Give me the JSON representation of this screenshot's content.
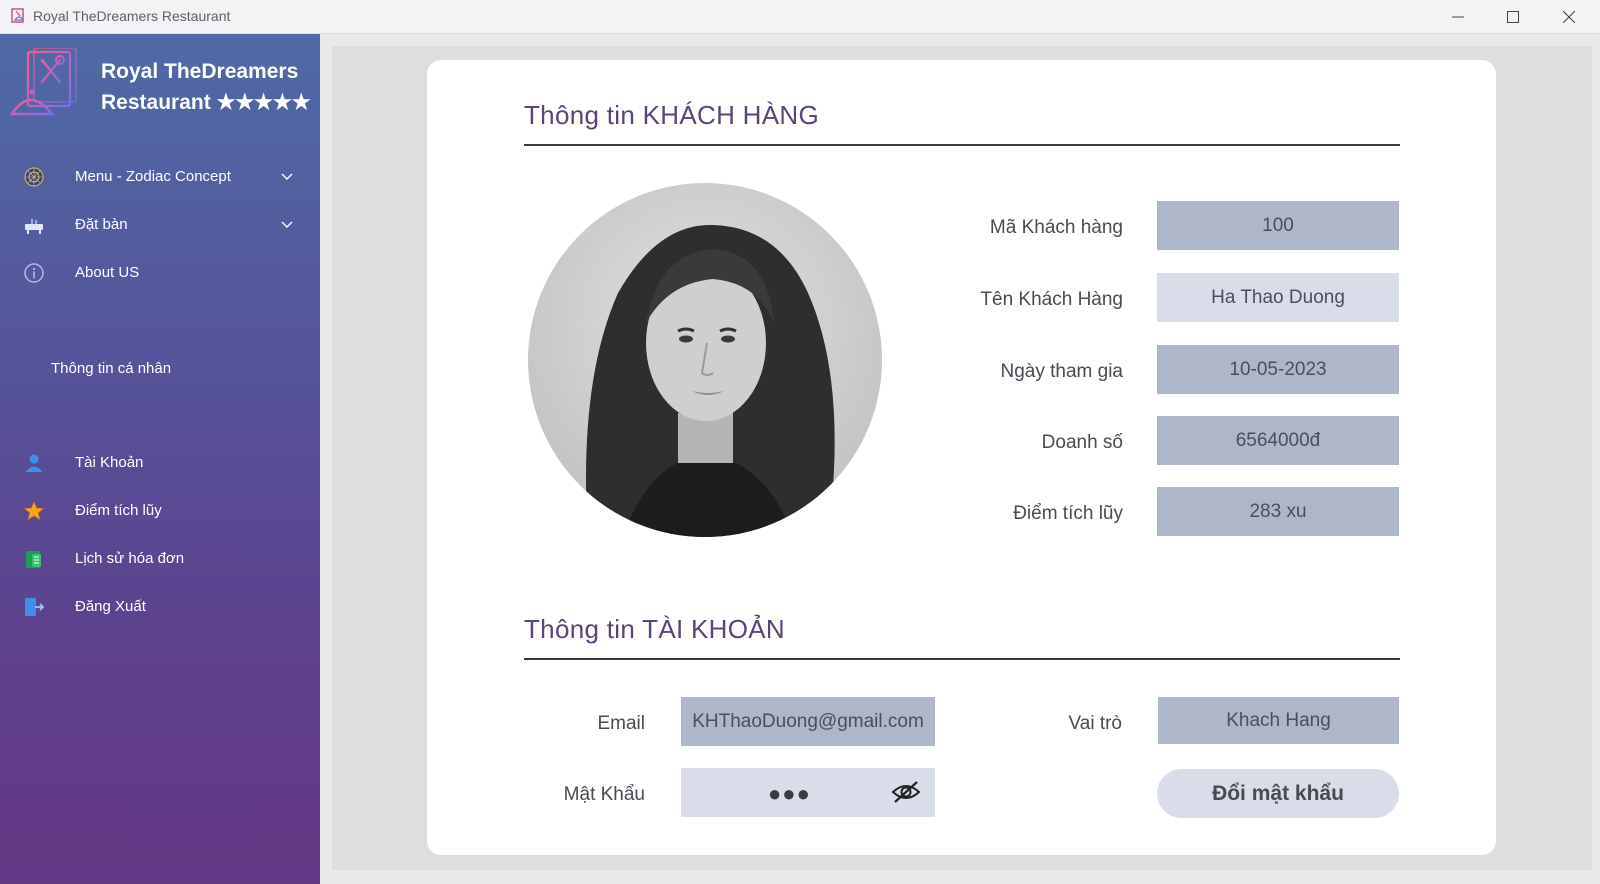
{
  "window": {
    "title": "Royal TheDreamers Restaurant"
  },
  "sidebar": {
    "brand_line1": "Royal TheDreamers",
    "brand_line2": "Restaurant ★★★★★",
    "menu": [
      {
        "label": "Menu - Zodiac Concept",
        "icon": "zodiac-wheel-icon",
        "has_dropdown": true
      },
      {
        "label": "Đặt bàn",
        "icon": "dining-table-icon",
        "has_dropdown": true
      },
      {
        "label": "About US",
        "icon": "info-icon",
        "has_dropdown": false
      }
    ],
    "section_label": "Thông tin cá nhân",
    "personal": [
      {
        "label": "Tài Khoản",
        "icon": "user-icon"
      },
      {
        "label": "Điểm tích lũy",
        "icon": "star-icon"
      },
      {
        "label": "Lịch sử hóa đơn",
        "icon": "invoice-icon"
      },
      {
        "label": "Đăng Xuất",
        "icon": "logout-icon"
      }
    ]
  },
  "customer": {
    "section_title": "Thông tin KHÁCH HÀNG",
    "fields": [
      {
        "label": "Mã Khách hàng",
        "value": "100"
      },
      {
        "label": "Tên Khách Hàng",
        "value": "Ha Thao Duong"
      },
      {
        "label": "Ngày tham gia",
        "value": "10-05-2023"
      },
      {
        "label": "Doanh số",
        "value": "6564000đ"
      },
      {
        "label": "Điểm tích lũy",
        "value": "283 xu"
      }
    ]
  },
  "account": {
    "section_title": "Thông tin TÀI KHOẢN",
    "email_label": "Email",
    "email_value": "KHThaoDuong@gmail.com",
    "role_label": "Vai trò",
    "role_value": "Khach Hang",
    "password_label": "Mật Khẩu",
    "password_mask": "●●●",
    "change_password_label": "Đổi mật khẩu"
  },
  "colors": {
    "sidebar_top": "#4f6aa6",
    "sidebar_bottom": "#643885",
    "section_title": "#5b4578",
    "readonly_field": "#aeb6c9",
    "editable_field": "#d8dde9"
  }
}
